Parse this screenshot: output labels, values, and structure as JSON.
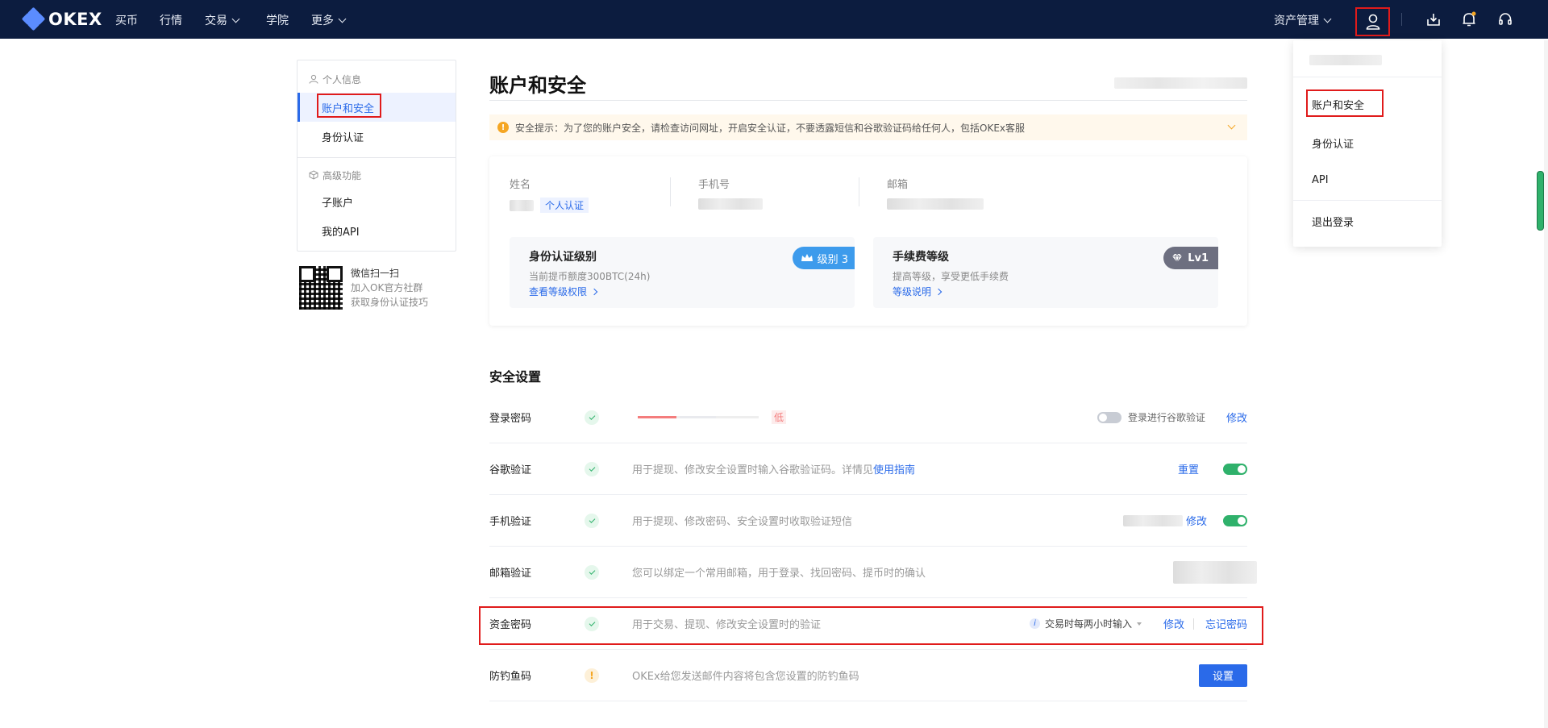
{
  "nav": {
    "brand": "OKEX",
    "links": [
      "买币",
      "行情",
      "交易",
      "学院",
      "更多"
    ],
    "asset_mgmt": "资产管理"
  },
  "sidebar": {
    "group1": "个人信息",
    "items1": [
      "账户和安全",
      "身份认证"
    ],
    "group2": "高级功能",
    "items2": [
      "子账户",
      "我的API"
    ]
  },
  "qr": {
    "title": "微信扫一扫",
    "line1": "加入OK官方社群",
    "line2": "获取身份认证技巧"
  },
  "main": {
    "title": "账户和安全",
    "alert": "安全提示：为了您的账户安全，请检查访问网址，开启安全认证，不要透露短信和谷歌验证码给任何人，包括OKEx客服",
    "info": {
      "name_label": "姓名",
      "verify_tag": "个人认证",
      "phone_label": "手机号",
      "email_label": "邮箱"
    },
    "id_level": {
      "title": "身份认证级别",
      "sub": "当前提币额度300BTC(24h)",
      "link": "查看等级权限",
      "badge": "级别 3"
    },
    "fee_level": {
      "title": "手续费等级",
      "sub": "提高等级，享受更低手续费",
      "link": "等级说明",
      "badge": "Lv1"
    },
    "security_title": "安全设置",
    "rows": {
      "login": {
        "label": "登录密码",
        "strength": "低",
        "toggle_label": "登录进行谷歌验证",
        "action": "修改"
      },
      "google": {
        "label": "谷歌验证",
        "desc": "用于提现、修改安全设置时输入谷歌验证码。详情见",
        "desc_link": "使用指南",
        "action": "重置"
      },
      "phone": {
        "label": "手机验证",
        "desc": "用于提现、修改密码、安全设置时收取验证短信",
        "action": "修改"
      },
      "email": {
        "label": "邮箱验证",
        "desc": "您可以绑定一个常用邮箱，用于登录、找回密码、提币时的确认"
      },
      "fund": {
        "label": "资金密码",
        "desc": "用于交易、提现、修改安全设置时的验证",
        "mode": "交易时每两小时输入",
        "action": "修改",
        "forgot": "忘记密码"
      },
      "phish": {
        "label": "防钓鱼码",
        "desc": "OKEx给您发送邮件内容将包含您设置的防钓鱼码",
        "action": "设置"
      }
    }
  },
  "dropdown": {
    "items": [
      "账户和安全",
      "身份认证",
      "API",
      "退出登录"
    ]
  },
  "colors": {
    "nav_bg": "#0c1c3f",
    "accent": "#2a6ae9",
    "success": "#2fb16b",
    "highlight_box": "#e01b1b"
  }
}
